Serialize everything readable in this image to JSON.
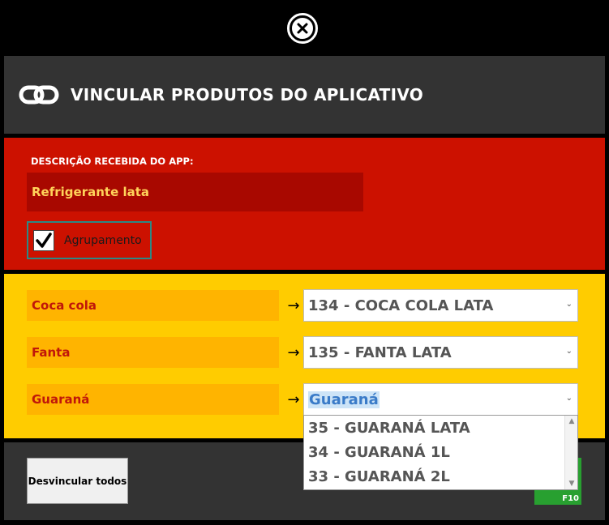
{
  "dialog": {
    "title": "VINCULAR PRODUTOS DO APLICATIVO",
    "close_icon": "close-circle-icon",
    "link_icon": "chain-link-icon"
  },
  "app_description": {
    "label": "DESCRIÇÃO RECEBIDA DO APP:",
    "value": "Refrigerante lata"
  },
  "grouping": {
    "label": "Agrupamento",
    "checked": true
  },
  "mappings": [
    {
      "app_item": "Coca cola",
      "arrow": "→",
      "selected": "134 - COCA COLA LATA"
    },
    {
      "app_item": "Fanta",
      "arrow": "→",
      "selected": "135 - FANTA LATA"
    },
    {
      "app_item": "Guaraná",
      "arrow": "→",
      "selected": "Guaraná"
    }
  ],
  "dropdown_options": [
    "35  - GUARANÁ LATA",
    "34  - GUARANÁ 1L",
    "33  - GUARANÁ 2L"
  ],
  "footer": {
    "unlink_all_label": "Desvincular todos",
    "confirm_shortcut": "F10"
  },
  "colors": {
    "header_bg": "#333333",
    "red_panel": "#cc1100",
    "yellow_panel": "#ffcc00",
    "confirm_green": "#28a030"
  }
}
